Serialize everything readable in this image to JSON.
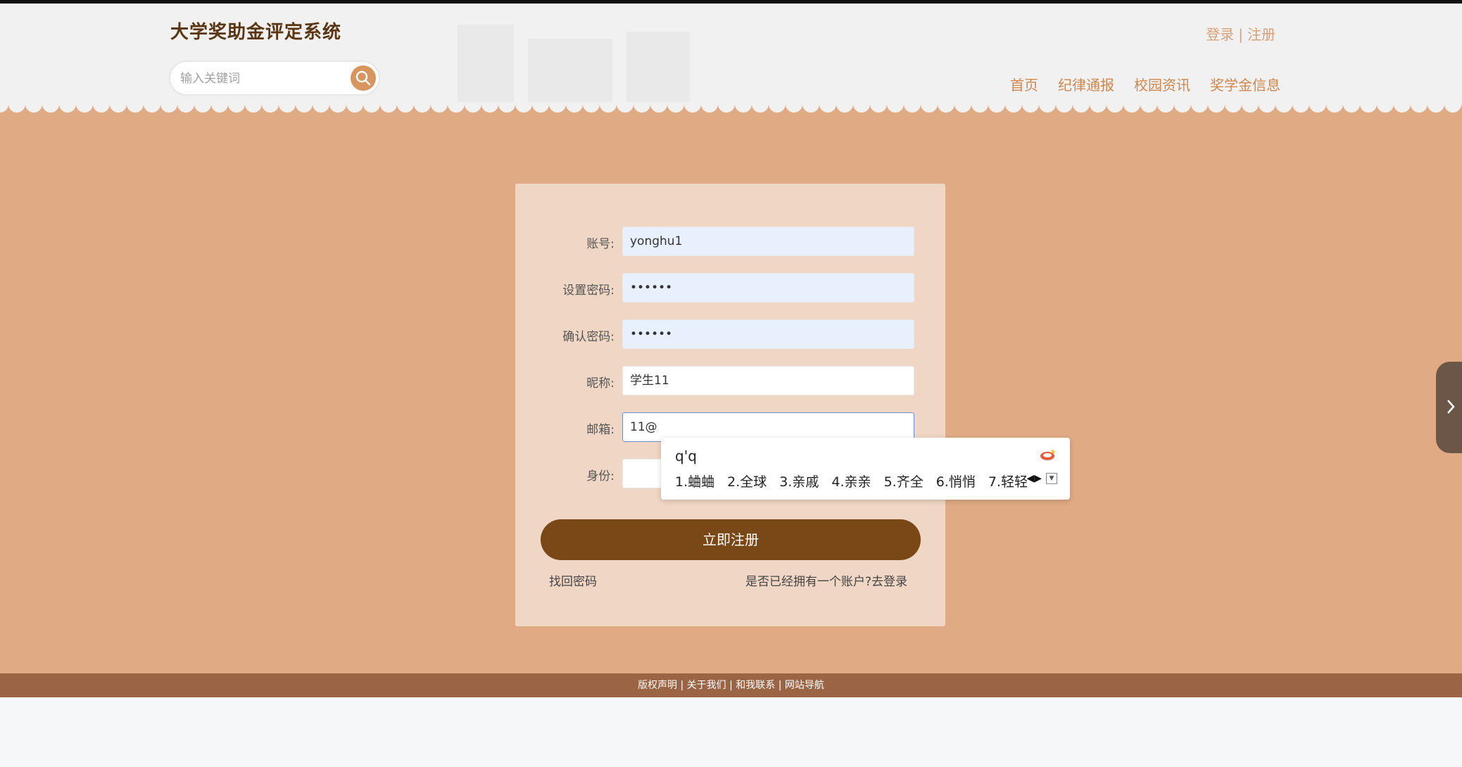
{
  "header": {
    "site_title": "大学奖助金评定系统",
    "auth": {
      "login": "登录",
      "separator": "|",
      "register": "注册"
    },
    "search": {
      "placeholder": "输入关键词"
    },
    "nav": [
      "首页",
      "纪律通报",
      "校园资讯",
      "奖学金信息"
    ]
  },
  "form": {
    "fields": [
      {
        "label": "账号:",
        "value": "yonghu1"
      },
      {
        "label": "设置密码:",
        "value": "••••••"
      },
      {
        "label": "确认密码:",
        "value": "••••••"
      },
      {
        "label": "昵称:",
        "value": "学生11"
      },
      {
        "label": "邮箱:",
        "value": "11@"
      },
      {
        "label": "身份:",
        "value": ""
      }
    ],
    "submit_label": "立即注册",
    "forgot_link": "找回密码",
    "login_link": "是否已经拥有一个账户?去登录"
  },
  "ime": {
    "composition": "q'q",
    "candidates": [
      "1.蛐蛐",
      "2.全球",
      "3.亲戚",
      "4.亲亲",
      "5.齐全",
      "6.悄悄",
      "7.轻轻"
    ]
  },
  "footer": {
    "text": "版权声明 | 关于我们 | 和我联系 | 网站导航"
  },
  "colors": {
    "brand": "#7a4716",
    "main_bg": "#e0ab84",
    "card_bg": "#f0d6c4",
    "footer_bg": "#9b6545",
    "nav": "#d0864d"
  }
}
